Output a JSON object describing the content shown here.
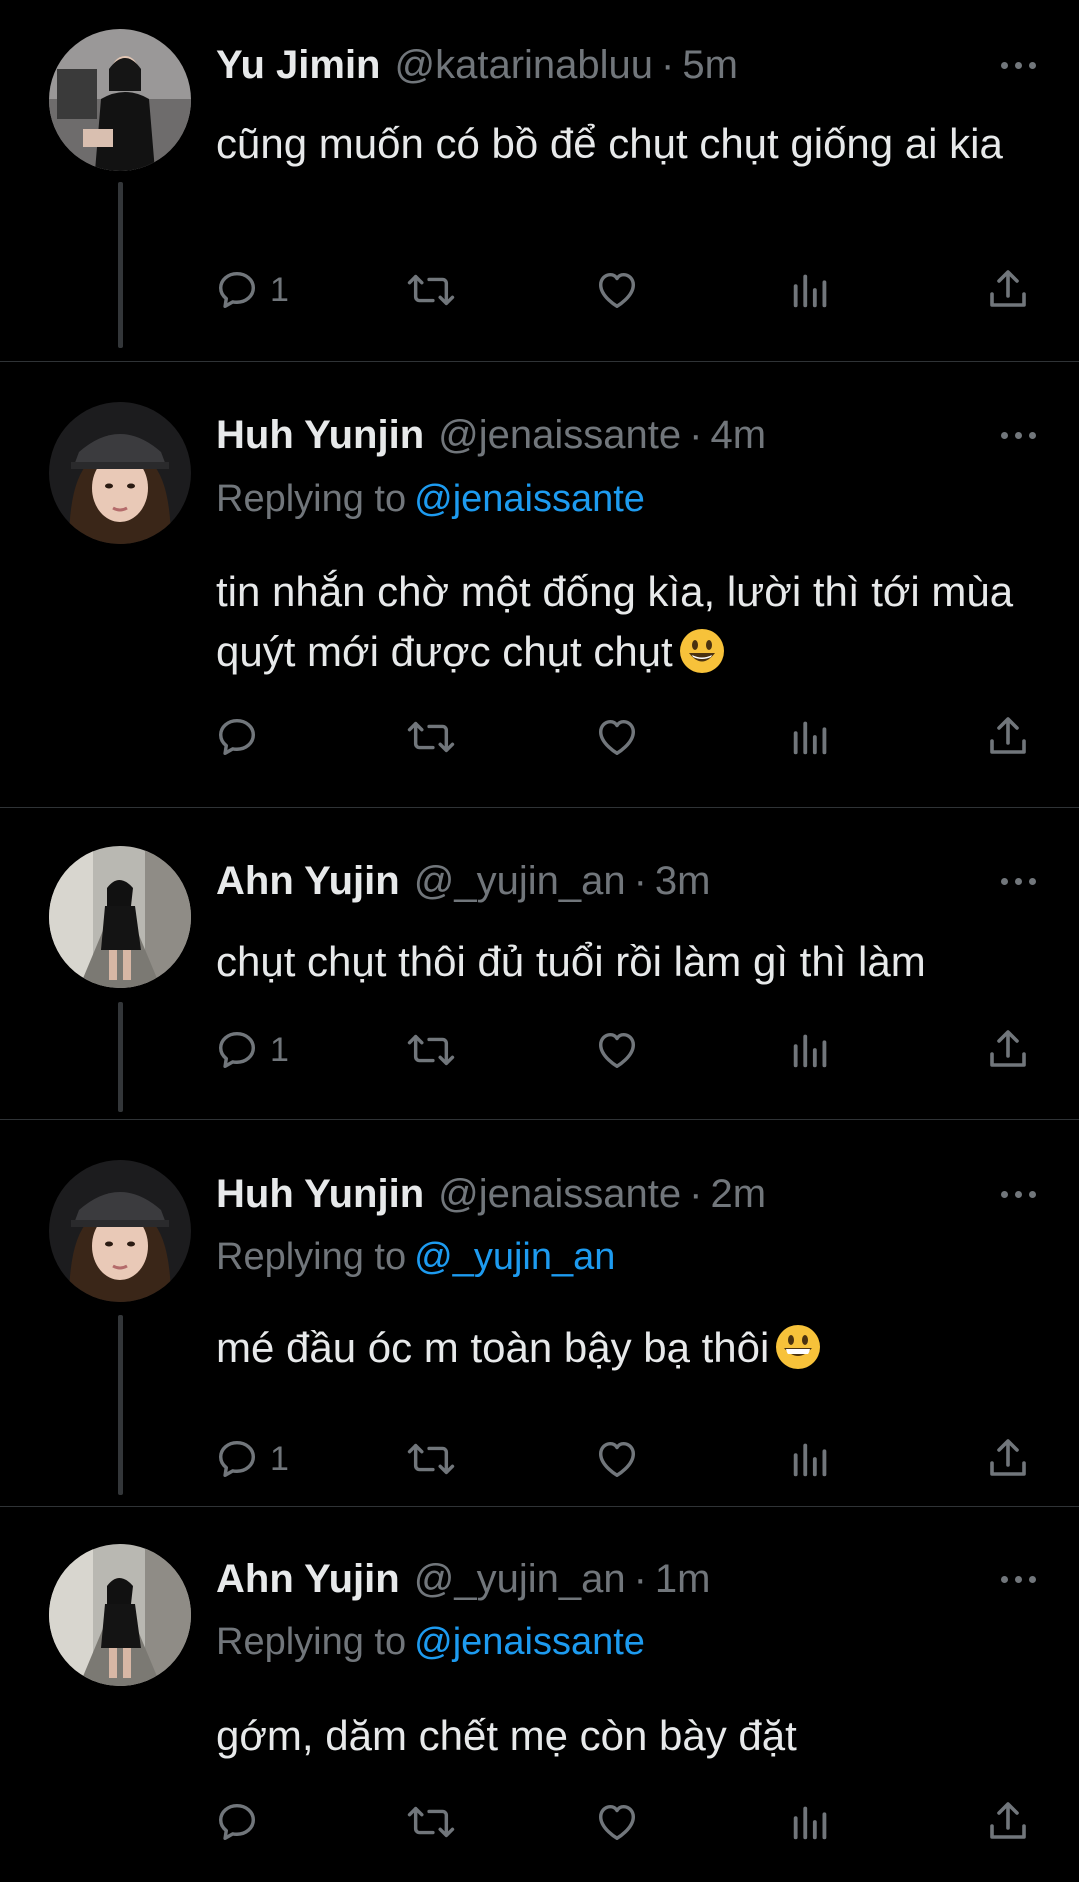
{
  "tweets": [
    {
      "name": "Yu Jimin",
      "handle": "@katarinabluu",
      "time": "5m",
      "replying_label": "",
      "replying_to": "",
      "text": "cũng muốn có bồ để chụt chụt giống ai kia",
      "emoji": "",
      "reply_count": "1",
      "avatar": "avatar-yu-jimin"
    },
    {
      "name": "Huh Yunjin",
      "handle": "@jenaissante",
      "time": "4m",
      "replying_label": "Replying to",
      "replying_to": "@jenaissante",
      "text": "tin nhắn chờ một đống kìa, lười thì tới mùa quýt mới được chụt chụt",
      "emoji": "smiling-face-emoji",
      "reply_count": "",
      "avatar": "avatar-huh-yunjin"
    },
    {
      "name": "Ahn Yujin",
      "handle": "@_yujin_an",
      "time": "3m",
      "replying_label": "",
      "replying_to": "",
      "text": "chụt chụt thôi đủ tuổi rồi làm gì thì làm",
      "emoji": "",
      "reply_count": "1",
      "avatar": "avatar-ahn-yujin"
    },
    {
      "name": "Huh Yunjin",
      "handle": "@jenaissante",
      "time": "2m",
      "replying_label": "Replying to",
      "replying_to": "@_yujin_an",
      "text": "mé đầu óc m toàn bậy bạ thôi",
      "emoji": "grinning-face-emoji",
      "reply_count": "1",
      "avatar": "avatar-huh-yunjin"
    },
    {
      "name": "Ahn Yujin",
      "handle": "@_yujin_an",
      "time": "1m",
      "replying_label": "Replying to",
      "replying_to": "@jenaissante",
      "text": "gớm, dăm chết mẹ còn bày đặt",
      "emoji": "",
      "reply_count": "",
      "avatar": "avatar-ahn-yujin"
    }
  ],
  "separator": "·",
  "colors": {
    "background": "#000000",
    "primary_text": "#e7e9ea",
    "secondary_text": "#71767b",
    "mention": "#1d9bf0",
    "divider": "#2f3336"
  },
  "icons": [
    "reply-icon",
    "retweet-icon",
    "like-icon",
    "views-icon",
    "share-icon",
    "more-icon"
  ]
}
